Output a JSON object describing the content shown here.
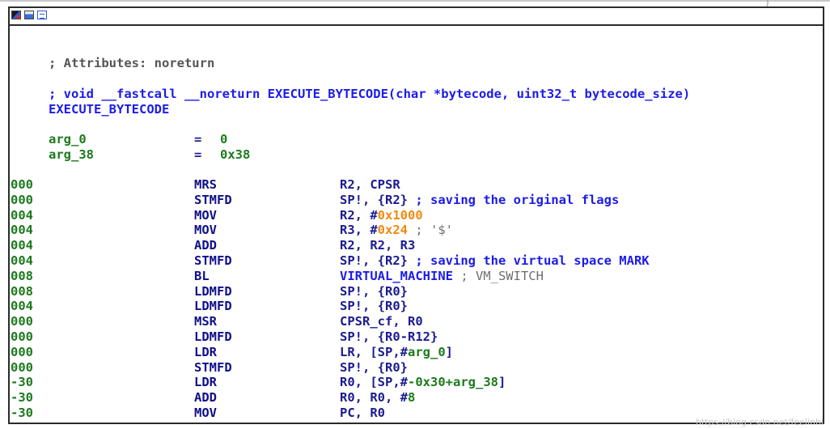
{
  "header": {
    "top_hint_left": "_",
    "top_hint_right": ")"
  },
  "comments": {
    "attributes": "; Attributes: noreturn",
    "prototype": "; void __fastcall __noreturn EXECUTE_BYTECODE(char *bytecode, uint32_t bytecode_size)"
  },
  "function_name": "EXECUTE_BYTECODE",
  "args": [
    {
      "name": "arg_0",
      "eq": "=",
      "value": "0"
    },
    {
      "name": "arg_38",
      "eq": "=",
      "value": "0x38"
    }
  ],
  "instructions": [
    {
      "addr": "000",
      "mnemonic": "MRS",
      "operands": [
        {
          "t": "R2, CPSR",
          "c": "navy"
        }
      ]
    },
    {
      "addr": "000",
      "mnemonic": "STMFD",
      "operands": [
        {
          "t": "SP!, {R2}",
          "c": "navy"
        },
        {
          "t": " ; saving the original flags",
          "c": "blue"
        }
      ]
    },
    {
      "addr": "004",
      "mnemonic": "MOV",
      "operands": [
        {
          "t": "R2, #",
          "c": "navy"
        },
        {
          "t": "0x1000",
          "c": "orange"
        }
      ]
    },
    {
      "addr": "004",
      "mnemonic": "MOV",
      "operands": [
        {
          "t": "R3, #",
          "c": "navy"
        },
        {
          "t": "0x24",
          "c": "orange"
        },
        {
          "t": " ; '$'",
          "c": "gray"
        }
      ]
    },
    {
      "addr": "004",
      "mnemonic": "ADD",
      "operands": [
        {
          "t": "R2, R2, R3",
          "c": "navy"
        }
      ]
    },
    {
      "addr": "004",
      "mnemonic": "STMFD",
      "operands": [
        {
          "t": "SP!, {R2}",
          "c": "navy"
        },
        {
          "t": " ; saving the virtual space MARK",
          "c": "blue"
        }
      ]
    },
    {
      "addr": "008",
      "mnemonic": "BL",
      "operands": [
        {
          "t": "VIRTUAL_MACHINE",
          "c": "blue"
        },
        {
          "t": " ; VM_SWITCH",
          "c": "gray"
        }
      ]
    },
    {
      "addr": "008",
      "mnemonic": "LDMFD",
      "operands": [
        {
          "t": "SP!, {R0}",
          "c": "navy"
        }
      ]
    },
    {
      "addr": "004",
      "mnemonic": "LDMFD",
      "operands": [
        {
          "t": "SP!, {R0}",
          "c": "navy"
        }
      ]
    },
    {
      "addr": "000",
      "mnemonic": "MSR",
      "operands": [
        {
          "t": "CPSR_cf, R0",
          "c": "navy"
        }
      ]
    },
    {
      "addr": "000",
      "mnemonic": "LDMFD",
      "operands": [
        {
          "t": "SP!, {R0-R12}",
          "c": "navy"
        }
      ]
    },
    {
      "addr": "000",
      "mnemonic": "LDR",
      "operands": [
        {
          "t": "LR, [SP,#",
          "c": "navy"
        },
        {
          "t": "arg_0",
          "c": "green"
        },
        {
          "t": "]",
          "c": "navy"
        }
      ]
    },
    {
      "addr": "000",
      "mnemonic": "STMFD",
      "operands": [
        {
          "t": "SP!, {R0}",
          "c": "navy"
        }
      ]
    },
    {
      "addr": "-30",
      "mnemonic": "LDR",
      "operands": [
        {
          "t": "R0, [SP,#",
          "c": "navy"
        },
        {
          "t": "-0x30+",
          "c": "green"
        },
        {
          "t": "arg_38",
          "c": "green"
        },
        {
          "t": "]",
          "c": "navy"
        }
      ]
    },
    {
      "addr": "-30",
      "mnemonic": "ADD",
      "operands": [
        {
          "t": "R0, R0, #",
          "c": "navy"
        },
        {
          "t": "8",
          "c": "green"
        }
      ]
    },
    {
      "addr": "-30",
      "mnemonic": "MOV",
      "operands": [
        {
          "t": "PC, R0",
          "c": "navy"
        }
      ]
    }
  ],
  "watermark": "https://blog.csdn.net/feelinhi"
}
